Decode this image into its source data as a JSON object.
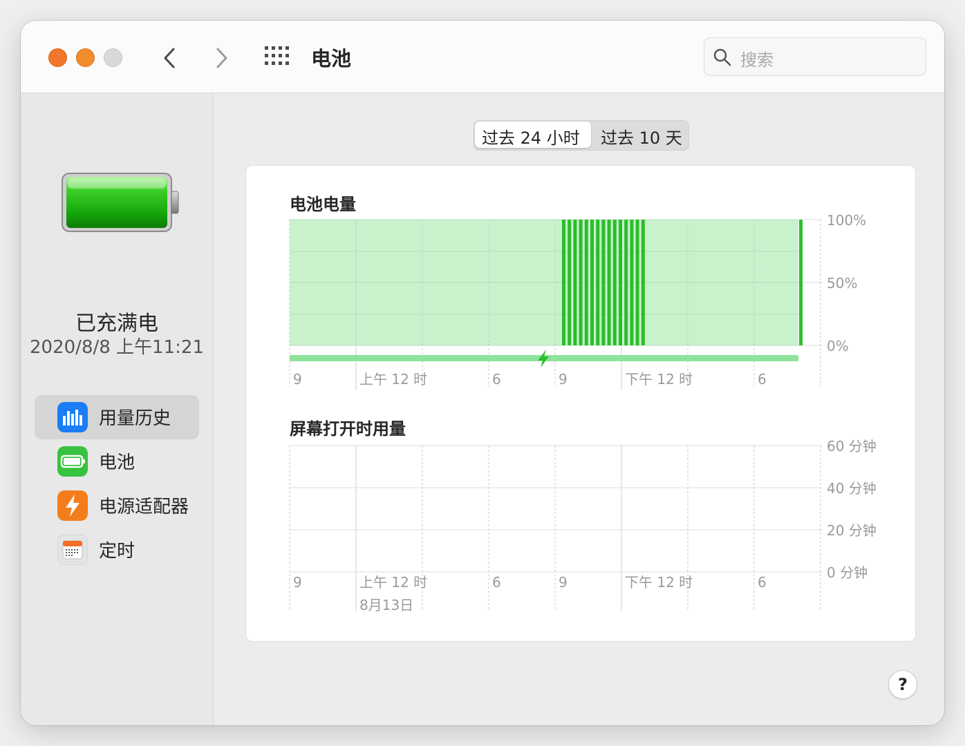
{
  "window": {
    "title": "电池"
  },
  "search": {
    "placeholder": "搜索"
  },
  "sidebar": {
    "status": "已充满电",
    "status_time": "2020/8/8 上午11:21",
    "items": [
      {
        "label": "用量历史",
        "icon": "bar-chart-icon",
        "active": true,
        "color": "#1a7df5"
      },
      {
        "label": "电池",
        "icon": "battery-icon",
        "active": false,
        "color": "#37c23f"
      },
      {
        "label": "电源适配器",
        "icon": "lightning-icon",
        "active": false,
        "color": "#f37d1b"
      },
      {
        "label": "定时",
        "icon": "calendar-icon",
        "active": false,
        "color": "#e8e8e8"
      }
    ]
  },
  "tabs": [
    {
      "label": "过去 24 小时",
      "selected": true
    },
    {
      "label": "过去 10 天",
      "selected": false
    }
  ],
  "help_label": "?",
  "colors": {
    "accent_green": "#2bbd2b",
    "fill_green": "#c8f2cc",
    "charging_bar": "#8de39a"
  },
  "chart_data": [
    {
      "type": "area",
      "title": "电池电量",
      "x_tick_labels": [
        "9",
        "上午 12 时",
        "6",
        "9",
        "下午 12 时",
        "6"
      ],
      "y_tick_labels": [
        "100%",
        "50%",
        "0%"
      ],
      "ylim": [
        0,
        100
      ],
      "series": [
        {
          "values": [
            100,
            100,
            100,
            100,
            100,
            100,
            100,
            100,
            100,
            100,
            100,
            100,
            100,
            100,
            100,
            100
          ]
        }
      ],
      "charging_indicator": true
    },
    {
      "type": "bar",
      "title": "屏幕打开时用量",
      "x_tick_labels": [
        "9",
        "上午 12 时",
        "6",
        "9",
        "下午 12 时",
        "6"
      ],
      "x_date_label": "8月13日",
      "y_tick_labels": [
        "60 分钟",
        "40 分钟",
        "20 分钟",
        "0 分钟"
      ],
      "ylim": [
        0,
        60
      ],
      "values": []
    }
  ]
}
